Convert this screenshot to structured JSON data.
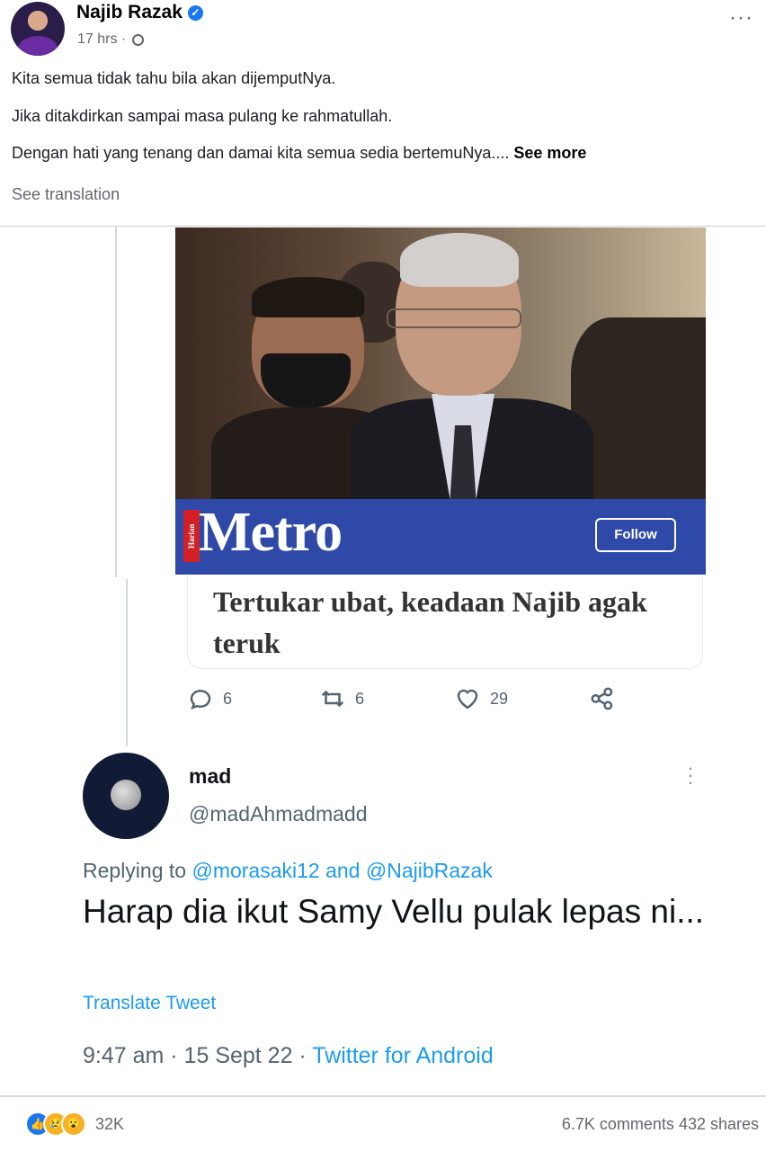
{
  "post": {
    "author": "Najib Razak",
    "time": "17 hrs",
    "time_separator": "·",
    "lines": [
      "Kita semua tidak tahu bila akan dijemputNya.",
      "Jika ditakdirkan sampai masa pulang ke rahmatullah.",
      "Dengan hati yang tenang dan damai kita semua sedia bertemuNya...."
    ],
    "see_more": "See more",
    "see_translation": "See translation",
    "more_options": "···",
    "verified_mark": "✓"
  },
  "embedded_tweet": {
    "publisher": "Metro",
    "publisher_prefix": "Harian",
    "follow_label": "Follow",
    "headline": "Tertukar ubat, keadaan Najib agak teruk",
    "replies": "6",
    "retweets": "6",
    "likes": "29"
  },
  "reply_tweet": {
    "name": "mad",
    "handle": "@madAhmadmadd",
    "replying_prefix": "Replying to",
    "replying_to_1": "@morasaki12",
    "replying_and": "and",
    "replying_to_2": "@NajibRazak",
    "text": "Harap dia ikut Samy Vellu pulak lepas ni...",
    "translate": "Translate Tweet",
    "time": "9:47 am · 15 Sept 22 ·",
    "source": "Twitter for Android"
  },
  "footer": {
    "reaction_count": "32K",
    "comments": "6.7K comments",
    "shares": "432 shares"
  },
  "colors": {
    "metro_blue": "#2e49a8",
    "twitter_blue": "#1d9bf0",
    "facebook_blue": "#1877f2"
  },
  "icons": [
    "verified-icon",
    "globe-icon",
    "more-options-icon",
    "reply-icon",
    "retweet-icon",
    "like-icon",
    "share-icon",
    "like-reaction-icon",
    "sad-reaction-icon",
    "wow-reaction-icon"
  ]
}
